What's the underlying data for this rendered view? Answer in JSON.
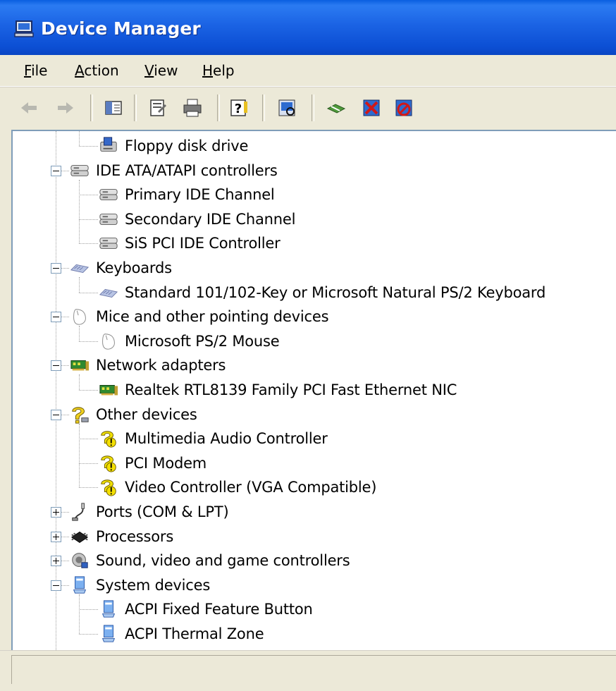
{
  "window": {
    "title": "Device Manager"
  },
  "menu": [
    "File",
    "Action",
    "View",
    "Help"
  ],
  "toolbar": {
    "buttons": [
      "back-icon",
      "forward-icon",
      "show-hide-console-tree-icon",
      "properties-icon",
      "print-icon",
      "help-icon",
      "scan-hardware-icon",
      "update-driver-icon",
      "uninstall-icon",
      "disable-icon"
    ]
  },
  "tree": {
    "items": [
      {
        "label": "Floppy disk drive",
        "icon": "floppy-drive-icon",
        "level": 1
      },
      {
        "label": "IDE ATA/ATAPI controllers",
        "icon": "ide-controller-icon",
        "level": 0,
        "expanded": true
      },
      {
        "label": "Primary IDE Channel",
        "icon": "ide-controller-icon",
        "level": 1
      },
      {
        "label": "Secondary IDE Channel",
        "icon": "ide-controller-icon",
        "level": 1
      },
      {
        "label": "SiS PCI IDE Controller",
        "icon": "ide-controller-icon",
        "level": 1
      },
      {
        "label": "Keyboards",
        "icon": "keyboard-icon",
        "level": 0,
        "expanded": true
      },
      {
        "label": "Standard 101/102-Key or Microsoft Natural PS/2 Keyboard",
        "icon": "keyboard-icon",
        "level": 1
      },
      {
        "label": "Mice and other pointing devices",
        "icon": "mouse-icon",
        "level": 0,
        "expanded": true
      },
      {
        "label": "Microsoft PS/2 Mouse",
        "icon": "mouse-icon",
        "level": 1
      },
      {
        "label": "Network adapters",
        "icon": "network-card-icon",
        "level": 0,
        "expanded": true
      },
      {
        "label": "Realtek RTL8139 Family PCI Fast Ethernet NIC",
        "icon": "network-card-icon",
        "level": 1
      },
      {
        "label": "Other devices",
        "icon": "unknown-device-icon",
        "level": 0,
        "expanded": true
      },
      {
        "label": "Multimedia Audio Controller",
        "icon": "warning-device-icon",
        "level": 1
      },
      {
        "label": "PCI Modem",
        "icon": "warning-device-icon",
        "level": 1
      },
      {
        "label": "Video Controller (VGA Compatible)",
        "icon": "warning-device-icon",
        "level": 1
      },
      {
        "label": "Ports (COM & LPT)",
        "icon": "port-icon",
        "level": 0,
        "expanded": false
      },
      {
        "label": "Processors",
        "icon": "processor-icon",
        "level": 0,
        "expanded": false
      },
      {
        "label": "Sound, video and game controllers",
        "icon": "sound-icon",
        "level": 0,
        "expanded": false
      },
      {
        "label": "System devices",
        "icon": "system-device-icon",
        "level": 0,
        "expanded": true
      },
      {
        "label": "ACPI Fixed Feature Button",
        "icon": "system-device-icon",
        "level": 1
      },
      {
        "label": "ACPI Thermal Zone",
        "icon": "system-device-icon",
        "level": 1
      }
    ]
  }
}
